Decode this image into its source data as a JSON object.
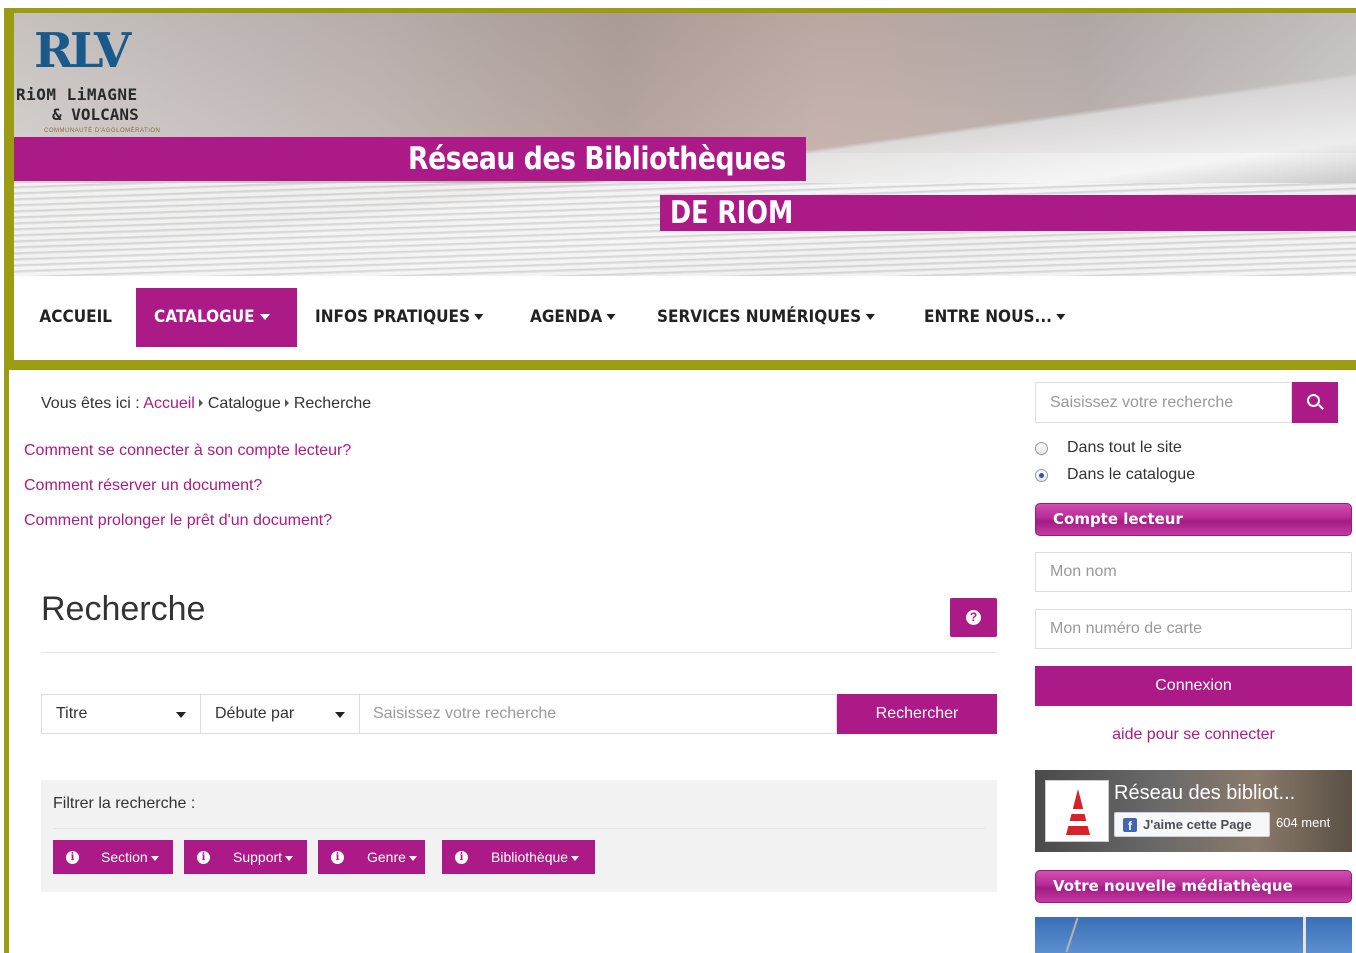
{
  "brand": {
    "logo_letters": "RLV",
    "logo_line1": "RiOM LiMAGNE",
    "logo_line2": "& VOLCANS",
    "logo_line3": "COMMUNAUTÉ D'AGGLOMÉRATION",
    "title_line1": "Réseau des Bibliothèques",
    "title_line2": "DE RIOM",
    "accent_color": "#ab1a87",
    "frame_color": "#9c9c12"
  },
  "nav": {
    "items": [
      {
        "label": "ACCUEIL",
        "dropdown": false,
        "active": false
      },
      {
        "label": "CATALOGUE",
        "dropdown": true,
        "active": true
      },
      {
        "label": "INFOS PRATIQUES",
        "dropdown": true,
        "active": false
      },
      {
        "label": "AGENDA",
        "dropdown": true,
        "active": false
      },
      {
        "label": "SERVICES NUMÉRIQUES",
        "dropdown": true,
        "active": false
      },
      {
        "label": "ENTRE NOUS...",
        "dropdown": true,
        "active": false
      }
    ]
  },
  "breadcrumb": {
    "prefix": "Vous êtes ici :",
    "items": [
      "Accueil",
      "Catalogue",
      "Recherche"
    ]
  },
  "help_links": [
    "Comment se connecter à son compte lecteur?",
    "Comment réserver un document?",
    "Comment prolonger le prêt d'un document?"
  ],
  "main": {
    "title": "Recherche",
    "help_icon": "question-circle-icon",
    "search": {
      "field_select": "Titre",
      "operator_select": "Débute par",
      "placeholder": "Saisissez votre recherche",
      "button": "Rechercher"
    },
    "filters": {
      "label": "Filtrer la recherche :",
      "buttons": [
        "Section",
        "Support",
        "Genre",
        "Bibliothèque"
      ]
    }
  },
  "sidebar": {
    "search_placeholder": "Saisissez votre recherche",
    "search_icon": "search-icon",
    "scope_options": [
      {
        "label": "Dans tout le site",
        "checked": false
      },
      {
        "label": "Dans le catalogue",
        "checked": true
      }
    ],
    "account": {
      "heading": "Compte lecteur",
      "name_placeholder": "Mon nom",
      "card_placeholder": "Mon numéro de carte",
      "login_button": "Connexion",
      "help_link": "aide pour se connecter"
    },
    "facebook": {
      "page_title": "Réseau des bibliot...",
      "like_button": "J'aime cette Page",
      "like_count": "604 ment"
    },
    "news_heading": "Votre nouvelle médiathèque"
  }
}
